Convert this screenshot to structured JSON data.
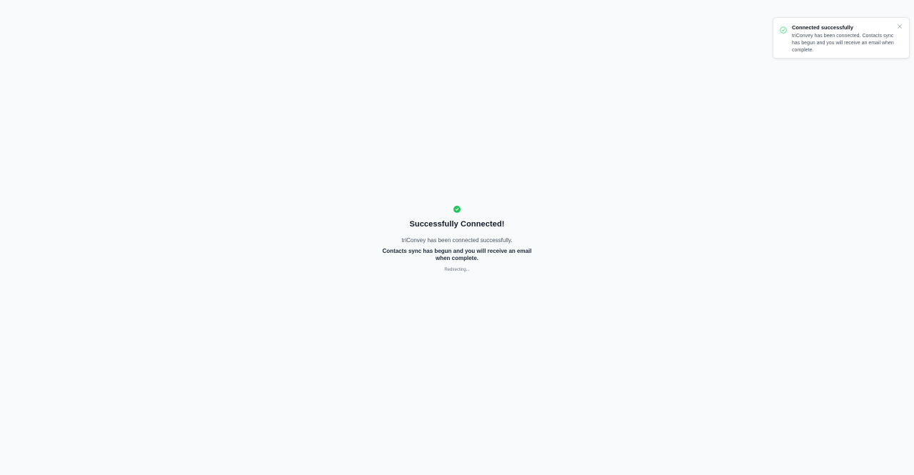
{
  "status": {
    "icon": "check-circle-icon",
    "title": "Successfully Connected!",
    "subtitle": "triConvey has been connected successfully.",
    "detail": "Contacts sync has begun and you will receive an email when complete.",
    "redirect": "Redirecting..."
  },
  "toast": {
    "icon": "check-circle-outline-icon",
    "title": "Connected successfully",
    "message": "triConvey has been connected. Contacts sync has begun and you will receive an email when complete.",
    "close_icon": "close-icon"
  },
  "colors": {
    "success": "#22c55e",
    "background": "#f9fafb"
  }
}
